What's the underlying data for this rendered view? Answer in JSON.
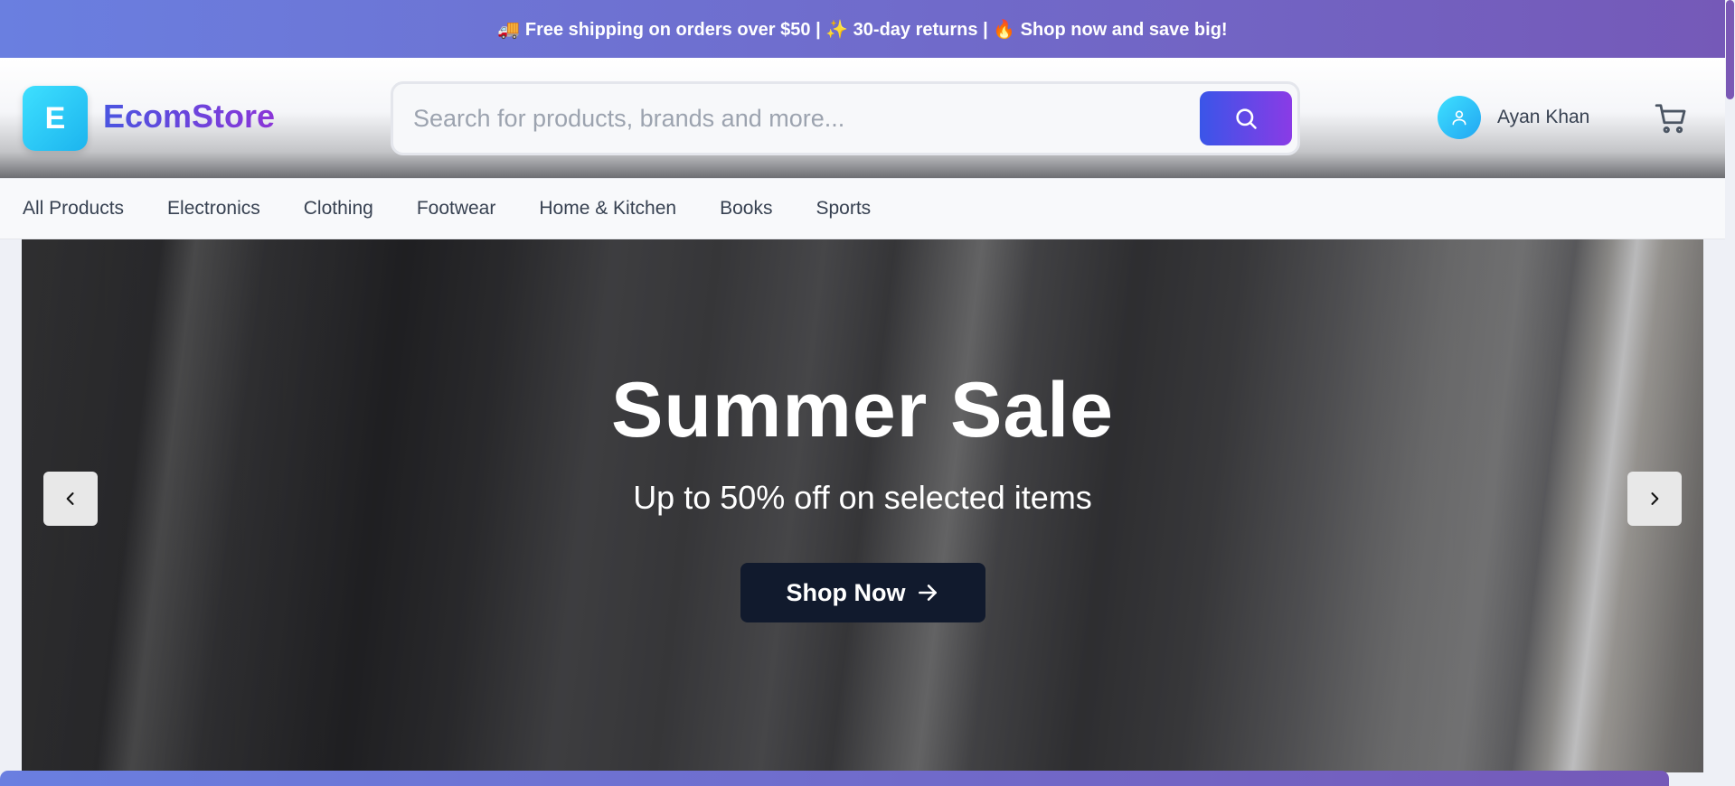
{
  "announcement": {
    "text": "🚚 Free shipping on orders over $50 | ✨ 30-day returns | 🔥 Shop now and save big!"
  },
  "header": {
    "logo_letter": "E",
    "brand": "EcomStore",
    "search_placeholder": "Search for products, brands and more...",
    "user_name": "Ayan Khan"
  },
  "nav": {
    "items": [
      {
        "label": "All Products"
      },
      {
        "label": "Electronics"
      },
      {
        "label": "Clothing"
      },
      {
        "label": "Footwear"
      },
      {
        "label": "Home & Kitchen"
      },
      {
        "label": "Books"
      },
      {
        "label": "Sports"
      }
    ]
  },
  "hero": {
    "title": "Summer Sale",
    "subtitle": "Up to 50% off on selected items",
    "cta_label": "Shop Now"
  },
  "icons": {
    "search": "search-icon",
    "user": "user-icon",
    "cart": "cart-icon",
    "prev": "chevron-left-icon",
    "next": "chevron-right-icon",
    "cta": "arrow-right-icon"
  },
  "colors": {
    "brand_gradient_start": "#6a7fe0",
    "brand_gradient_end": "#7559b8",
    "cta_background": "#111a2d"
  }
}
